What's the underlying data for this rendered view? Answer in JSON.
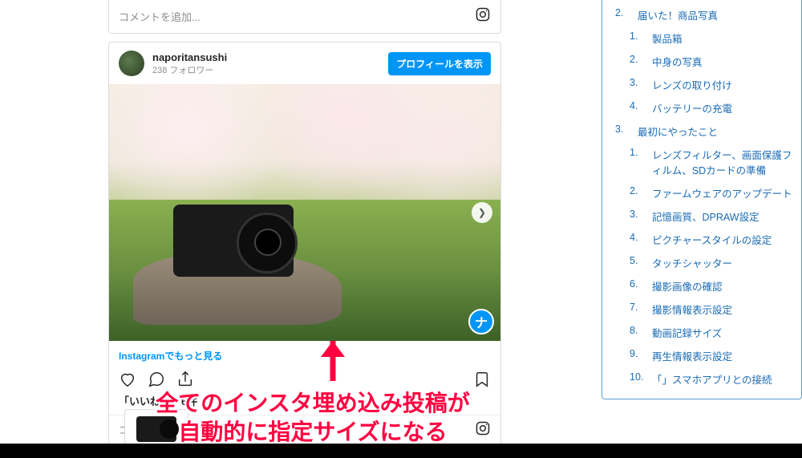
{
  "card_top": {
    "comment_placeholder": "コメントを追加..."
  },
  "embed": {
    "username": "naporitansushi",
    "followers": "238 フォロワー",
    "profile_button": "プロフィールを表示",
    "more_link": "Instagramでもっと見る",
    "likes_text": "「いいね！」6件",
    "comment_placeholder": "コメントを追加...",
    "nav_badge": "ナ"
  },
  "annotation": {
    "line1": "全てのインスタ埋め込み投稿が",
    "line2": "自動的に指定サイズになる"
  },
  "toc": [
    {
      "num": "2.",
      "text": "届いた！商品写真",
      "indent": 0
    },
    {
      "num": "1.",
      "text": "製品箱",
      "indent": 1
    },
    {
      "num": "2.",
      "text": "中身の写真",
      "indent": 1
    },
    {
      "num": "3.",
      "text": "レンズの取り付け",
      "indent": 1
    },
    {
      "num": "4.",
      "text": "バッテリーの充電",
      "indent": 1
    },
    {
      "num": "3.",
      "text": "最初にやったこと",
      "indent": 0
    },
    {
      "num": "1.",
      "text": "レンズフィルター、画面保護フィルム、SDカードの準備",
      "indent": 1
    },
    {
      "num": "2.",
      "text": "ファームウェアのアップデート",
      "indent": 1
    },
    {
      "num": "3.",
      "text": "記憶画質、DPRAW設定",
      "indent": 1
    },
    {
      "num": "4.",
      "text": "ピクチャースタイルの設定",
      "indent": 1
    },
    {
      "num": "5.",
      "text": "タッチシャッター",
      "indent": 1
    },
    {
      "num": "6.",
      "text": "撮影画像の確認",
      "indent": 1
    },
    {
      "num": "7.",
      "text": "撮影情報表示設定",
      "indent": 1
    },
    {
      "num": "8.",
      "text": "動画記録サイズ",
      "indent": 1
    },
    {
      "num": "9.",
      "text": "再生情報表示設定",
      "indent": 1
    },
    {
      "num": "10.",
      "text": "「」スマホアプリとの接続",
      "indent": 1
    }
  ]
}
